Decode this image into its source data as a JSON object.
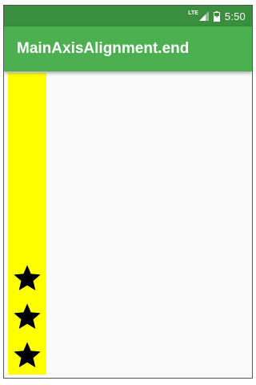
{
  "status_bar": {
    "network_label": "LTE",
    "time": "5:50",
    "icons": [
      "signal-icon",
      "battery-icon"
    ]
  },
  "app_bar": {
    "title": "MainAxisAlignment.end",
    "color": "#4caf50"
  },
  "column": {
    "background": "#ffff00",
    "main_axis_alignment": "end",
    "children": [
      {
        "icon": "star-icon",
        "color": "#000000"
      },
      {
        "icon": "star-icon",
        "color": "#000000"
      },
      {
        "icon": "star-icon",
        "color": "#000000"
      }
    ]
  }
}
